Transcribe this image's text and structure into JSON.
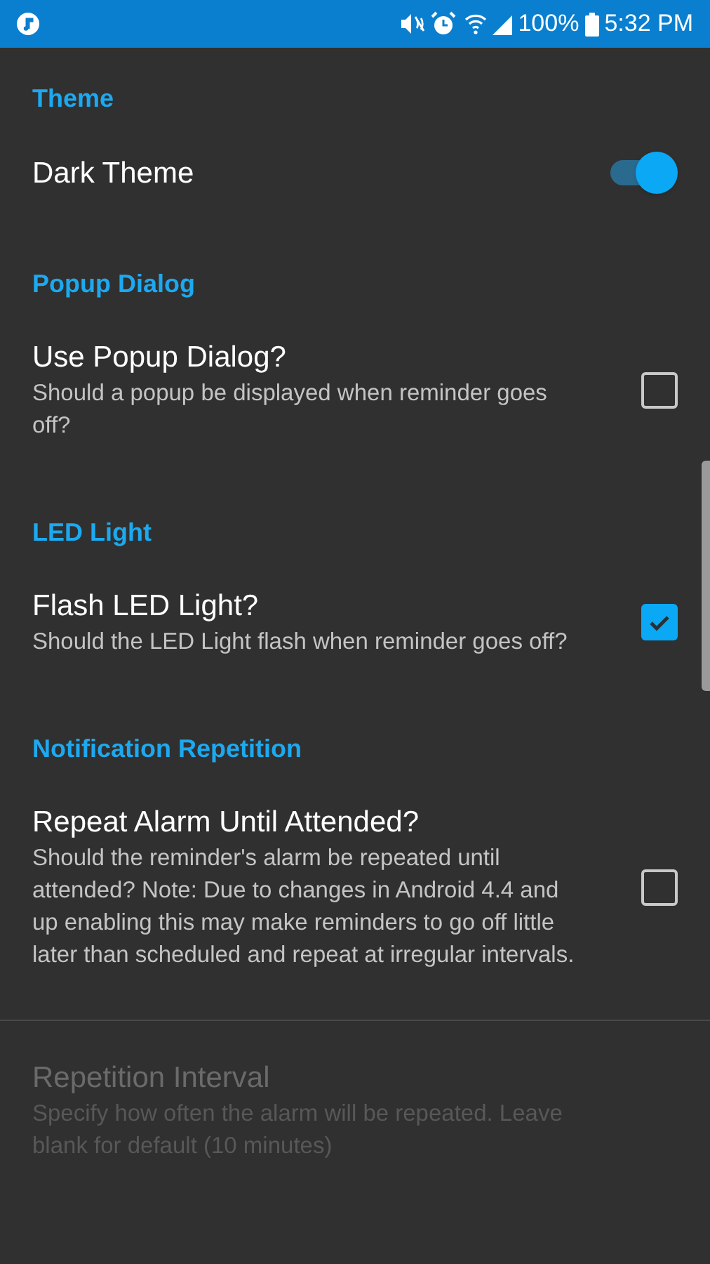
{
  "status_bar": {
    "battery": "100%",
    "time": "5:32 PM"
  },
  "sections": [
    {
      "header": "Theme",
      "items": [
        {
          "kind": "switch",
          "title": "Dark Theme",
          "on": true,
          "disabled": false
        }
      ]
    },
    {
      "header": "Popup Dialog",
      "items": [
        {
          "kind": "checkbox",
          "title": "Use Popup Dialog?",
          "summary": "Should a popup be displayed when reminder goes off?",
          "checked": false,
          "disabled": false
        }
      ]
    },
    {
      "header": "LED Light",
      "items": [
        {
          "kind": "checkbox",
          "title": "Flash LED Light?",
          "summary": "Should the LED Light flash when reminder goes off?",
          "checked": true,
          "disabled": false
        }
      ]
    },
    {
      "header": "Notification Repetition",
      "items": [
        {
          "kind": "checkbox",
          "title": "Repeat Alarm Until Attended?",
          "summary": "Should the reminder's alarm be repeated until attended? Note: Due to changes in Android 4.4 and up enabling this may make reminders to go off little later than scheduled and repeat at irregular intervals.",
          "checked": false,
          "disabled": false
        }
      ]
    },
    {
      "items": [
        {
          "kind": "plain",
          "title": "Repetition Interval",
          "summary": "Specify how often the alarm will be repeated. Leave blank for default (10 minutes)",
          "disabled": true
        }
      ]
    }
  ]
}
